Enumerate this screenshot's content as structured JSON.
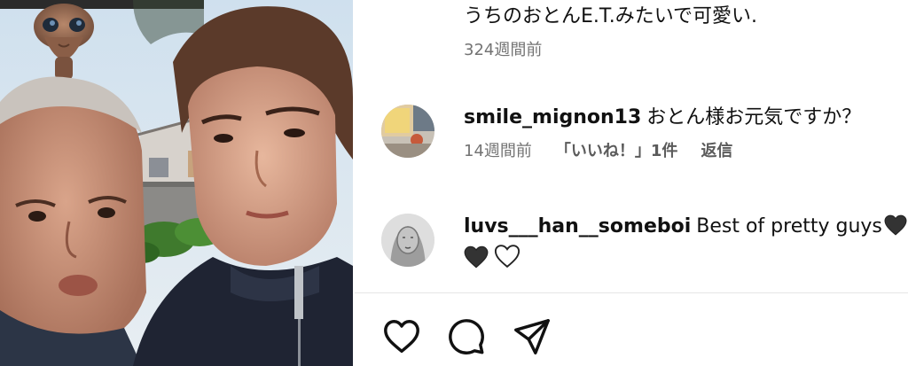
{
  "photo": {
    "alt": "selfie photo with E.T. figure"
  },
  "comments": [
    {
      "text": "うちのおとんE.T.みたいで可愛い.",
      "time": "324週間前"
    },
    {
      "username": "smile_mignon13",
      "text": "おとん様お元気ですか？",
      "time": "14週間前",
      "likes": "「いいね！」1件",
      "reply": "返信"
    },
    {
      "username": "luvs___han__someboi",
      "text": "Best of pretty guys"
    }
  ],
  "actions": {
    "like": "like-icon",
    "comment": "comment-icon",
    "share": "share-icon"
  },
  "colors": {
    "text": "#111111",
    "meta": "#737373",
    "black_heart": "#333333"
  }
}
